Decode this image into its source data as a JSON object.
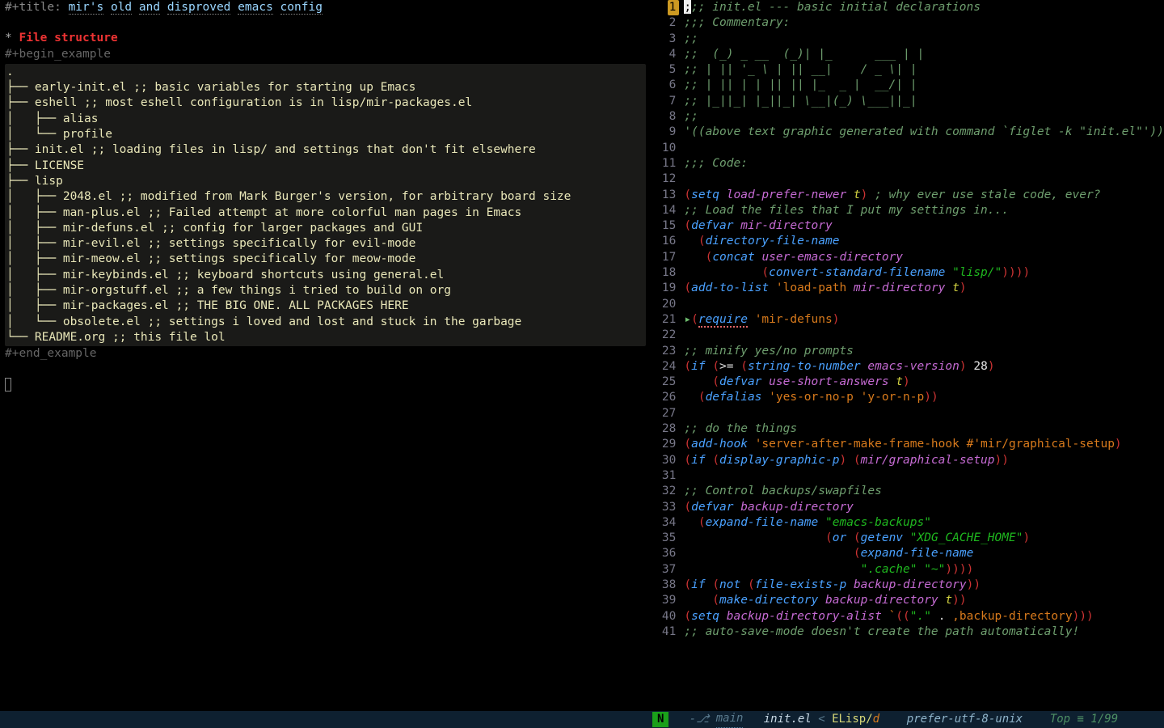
{
  "left": {
    "title_prefix": "#+title: ",
    "title_words": [
      "mir's",
      "old",
      "and",
      "disproved",
      "emacs",
      "config"
    ],
    "hdr_star": "* ",
    "hdr": "File structure",
    "begin": "#+begin_example",
    "end": "#+end_example",
    "tree": [
      ".",
      "├── early-init.el ;; basic variables for starting up Emacs",
      "├── eshell ;; most eshell configuration is in lisp/mir-packages.el",
      "│   ├── alias",
      "│   └── profile",
      "├── init.el ;; loading files in lisp/ and settings that don't fit elsewhere",
      "├── LICENSE",
      "├── lisp",
      "│   ├── 2048.el ;; modified from Mark Burger's version, for arbitrary board size",
      "│   ├── man-plus.el ;; Failed attempt at more colorful man pages in Emacs",
      "│   ├── mir-defuns.el ;; config for larger packages and GUI",
      "│   ├── mir-evil.el ;; settings specifically for evil-mode",
      "│   ├── mir-meow.el ;; settings specifically for meow-mode",
      "│   ├── mir-keybinds.el ;; keyboard shortcuts using general.el",
      "│   ├── mir-orgstuff.el ;; a few things i tried to build on org",
      "│   ├── mir-packages.el ;; THE BIG ONE. ALL PACKAGES HERE",
      "│   └── obsolete.el ;; settings i loved and lost and stuck in the garbage",
      "└── README.org ;; this file lol"
    ]
  },
  "right": {
    "lines": [
      ";;; init.el --- basic initial declarations",
      ";;; Commentary:",
      ";;",
      ";;  (_) _ __  (_)| |_      ___ | |",
      ";; | || '_ \\ | || __|    / _ \\| |",
      ";; | || | | || || |_  _ |  __/| |",
      ";; |_||_| |_||_| \\__|(_) \\___||_|",
      ";;",
      "'((above text graphic generated with command `figlet -k \"init.el\"'))",
      "",
      ";;; Code:",
      "",
      "(setq load-prefer-newer t) ; why ever use stale code, ever?",
      ";; Load the files that I put my settings in...",
      "(defvar mir-directory",
      "  (directory-file-name",
      "   (concat user-emacs-directory",
      "           (convert-standard-filename \"lisp/\"))))",
      "(add-to-list 'load-path mir-directory t)",
      "",
      "(require 'mir-defuns)",
      "",
      ";; minify yes/no prompts",
      "(if (>= (string-to-number emacs-version) 28)",
      "    (defvar use-short-answers t)",
      "  (defalias 'yes-or-no-p 'y-or-n-p))",
      "",
      ";; do the things",
      "(add-hook 'server-after-make-frame-hook #'mir/graphical-setup)",
      "(if (display-graphic-p) (mir/graphical-setup))",
      "",
      ";; Control backups/swapfiles",
      "(defvar backup-directory",
      "  (expand-file-name \"emacs-backups\"",
      "                    (or (getenv \"XDG_CACHE_HOME\")",
      "                        (expand-file-name",
      "                         \".cache\" \"~\"))))",
      "(if (not (file-exists-p backup-directory))",
      "    (make-directory backup-directory t))",
      "(setq backup-directory-alist `((\".\" . ,backup-directory)))",
      ";; auto-save-mode doesn't create the path automatically!"
    ],
    "current_line": 1
  },
  "modeline": {
    "indicator": "N",
    "branch_icon": "-⎇ ",
    "branch": "main",
    "file": "init.el",
    "sep": " < ",
    "mode_a": "ELisp/",
    "mode_b": "d",
    "encoding": "prefer-utf-8-unix",
    "pos_label": "Top",
    "pos_sep": " ≡ ",
    "pos_val": "1/99"
  }
}
